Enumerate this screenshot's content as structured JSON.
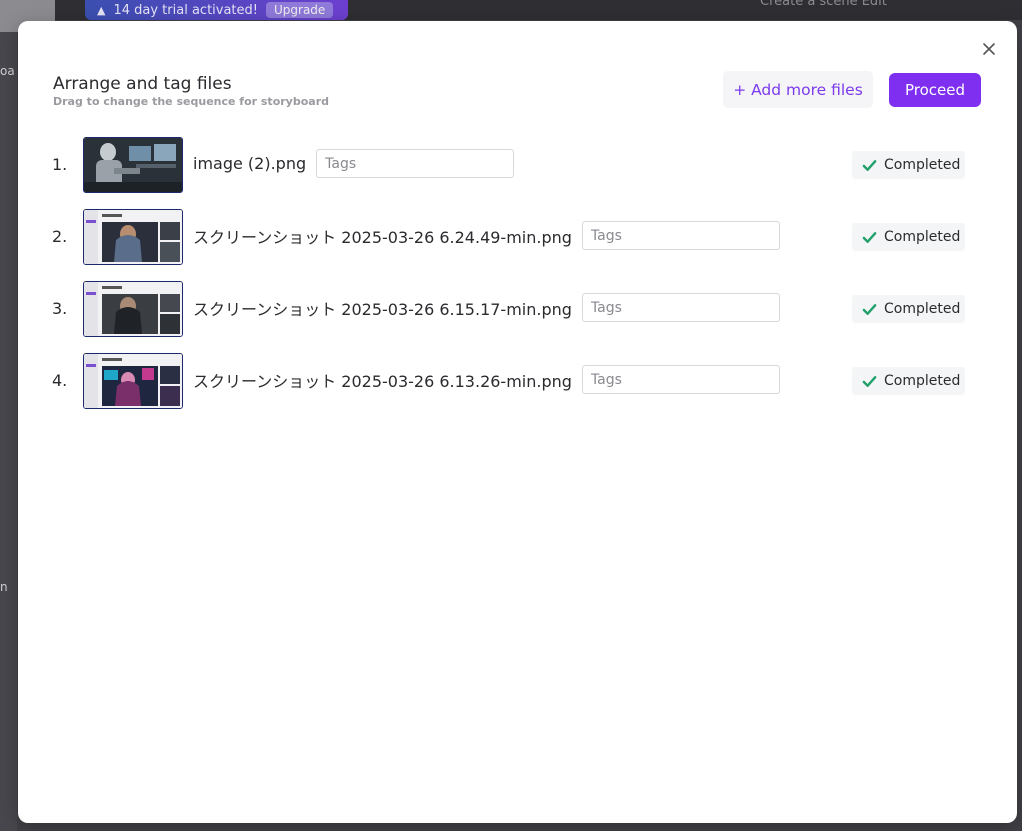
{
  "background": {
    "sidebar_text": "oa",
    "sidebar_text2": "n",
    "banner_text": "14 day trial activated!",
    "banner_button": "Upgrade",
    "right_text": "Create a scene        Edit"
  },
  "modal": {
    "title": "Arrange and tag files",
    "subtitle": "Drag to change the sequence for storyboard",
    "add_button": "+ Add more files",
    "proceed_button": "Proceed",
    "accent_color": "#7e2ff0",
    "success_color": "#22a06b"
  },
  "files": [
    {
      "number": "1.",
      "name": "image (2).png",
      "tags_placeholder": "Tags",
      "tags_value": "",
      "status": "Completed"
    },
    {
      "number": "2.",
      "name": "スクリーンショット 2025-03-26 6.24.49-min.png",
      "tags_placeholder": "Tags",
      "tags_value": "",
      "status": "Completed"
    },
    {
      "number": "3.",
      "name": "スクリーンショット 2025-03-26 6.15.17-min.png",
      "tags_placeholder": "Tags",
      "tags_value": "",
      "status": "Completed"
    },
    {
      "number": "4.",
      "name": "スクリーンショット 2025-03-26 6.13.26-min.png",
      "tags_placeholder": "Tags",
      "tags_value": "",
      "status": "Completed"
    }
  ]
}
